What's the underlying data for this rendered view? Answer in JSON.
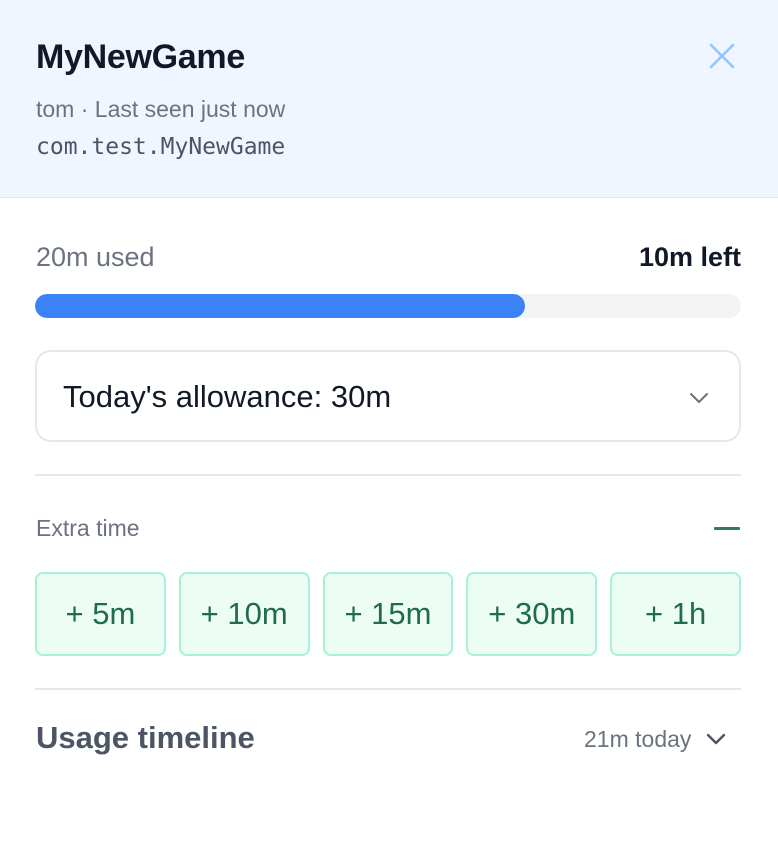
{
  "header": {
    "title": "MyNewGame",
    "subtitle": "tom · Last seen just now",
    "bundle_id": "com.test.MyNewGame",
    "close_icon": "close-icon",
    "background": "#eff6ff"
  },
  "usage": {
    "used_label": "20m used",
    "left_label": "10m left",
    "progress_fraction": 0.694,
    "bar_color": "#3b82f6"
  },
  "allowance": {
    "selected": "Today's allowance: 30m",
    "icon": "chevron-down-icon"
  },
  "extra_time": {
    "label": "Extra time",
    "collapse_icon": "minus-icon",
    "buttons": [
      "+ 5m",
      "+ 10m",
      "+ 15m",
      "+ 30m",
      "+ 1h"
    ],
    "accent": "#1f6b4a"
  },
  "timeline": {
    "title": "Usage timeline",
    "summary": "21m today",
    "icon": "chevron-down-icon"
  }
}
